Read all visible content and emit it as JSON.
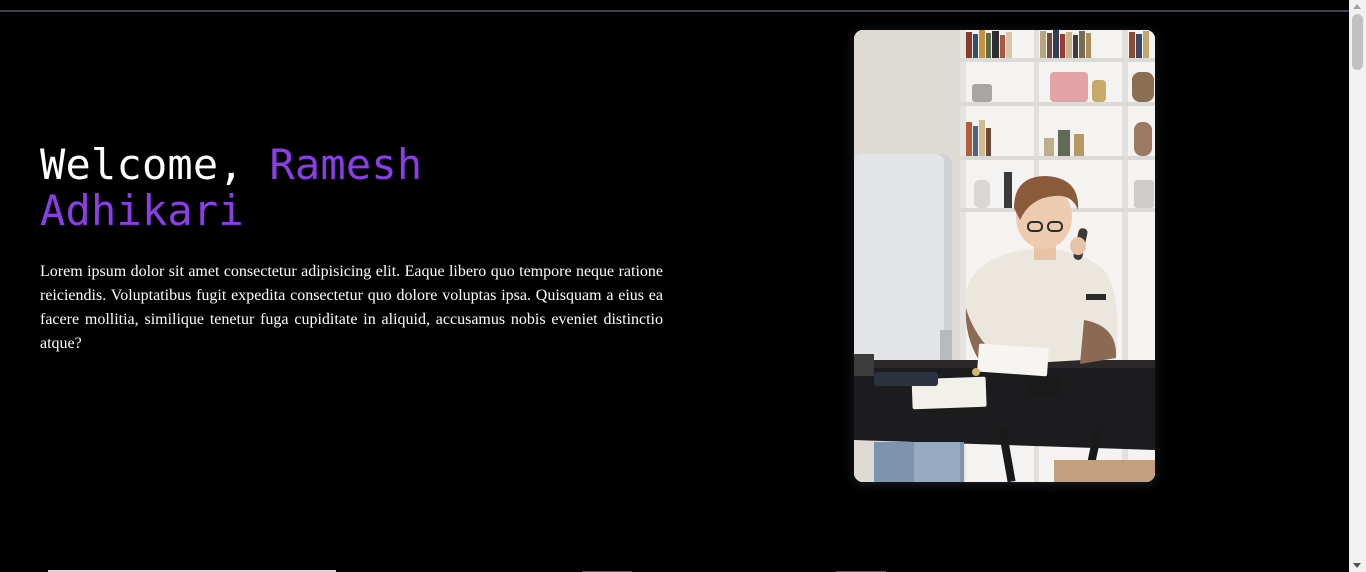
{
  "hero": {
    "greeting": "Welcome, ",
    "name_first": "Ramesh",
    "name_last": "Adhikari",
    "paragraph": "Lorem ipsum dolor sit amet consectetur adipisicing elit. Eaque libero quo tempore neque ratione reiciendis. Voluptatibus fugit expedita consectetur quo dolore voluptas ipsa. Quisquam a eius ea facere mollitia, similique tenetur fuga cupiditate in aliquid, accusamus nobis eveniet distinctio atque?"
  },
  "colors": {
    "background": "#000000",
    "accent": "#8b3ee6",
    "text": "#ffffff"
  },
  "photo": {
    "subject": "woman-at-desk-on-phone-photo"
  }
}
